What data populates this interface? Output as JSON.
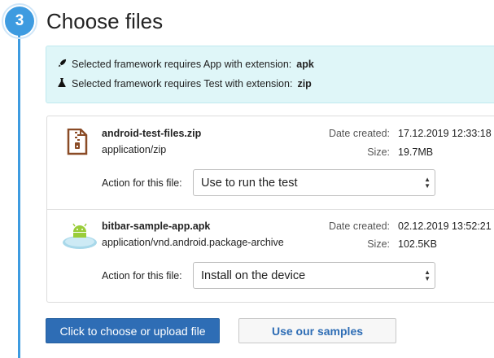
{
  "step": {
    "number": "3",
    "title": "Choose files"
  },
  "info": {
    "rows": [
      {
        "icon": "rocket-icon",
        "text": "Selected framework requires App with extension:",
        "ext": "apk"
      },
      {
        "icon": "flask-icon",
        "text": "Selected framework requires Test with extension:",
        "ext": "zip"
      }
    ]
  },
  "files": [
    {
      "icon": "zip-file-icon",
      "name": "android-test-files.zip",
      "type": "application/zip",
      "date_label": "Date created:",
      "date": "17.12.2019 12:33:18",
      "size_label": "Size:",
      "size": "19.7MB",
      "action_label": "Action for this file:",
      "action": "Use to run the test"
    },
    {
      "icon": "android-app-icon",
      "name": "bitbar-sample-app.apk",
      "type": "application/vnd.android.package-archive",
      "date_label": "Date created:",
      "date": "02.12.2019 13:52:21",
      "size_label": "Size:",
      "size": "102.5KB",
      "action_label": "Action for this file:",
      "action": "Install on the device"
    }
  ],
  "buttons": {
    "upload": "Click to choose or upload file",
    "samples": "Use our samples"
  },
  "colors": {
    "accent": "#3e9be0",
    "primary_button": "#2e6db5",
    "info_bg": "#dff6f8"
  }
}
